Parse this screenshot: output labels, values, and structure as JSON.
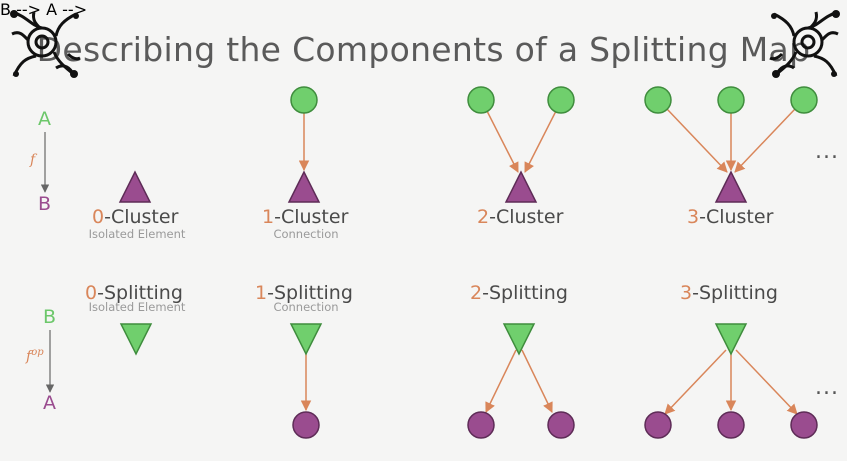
{
  "title": "Describing the Components of a Splitting Map",
  "colors": {
    "green_fill": "#70cf6d",
    "green_stroke": "#3f8d3d",
    "purple_fill": "#9a4c8f",
    "purple_stroke": "#5e2c57",
    "arrow": "#d9865a",
    "accent_number": "#d9865a",
    "text": "#4a4a4a"
  },
  "icons": {
    "corner_left": "ornament-icon",
    "corner_right": "ornament-icon"
  },
  "top_legend": {
    "top": "A",
    "function": "f",
    "bottom": "B"
  },
  "bottom_legend": {
    "top": "B",
    "function": "fop",
    "bottom": "A"
  },
  "clusters": [
    {
      "number": "0",
      "name": "-Cluster",
      "subtitle": "Isolated Element"
    },
    {
      "number": "1",
      "name": "-Cluster",
      "subtitle": "Connection"
    },
    {
      "number": "2",
      "name": "-Cluster",
      "subtitle": ""
    },
    {
      "number": "3",
      "name": "-Cluster",
      "subtitle": ""
    }
  ],
  "splittings": [
    {
      "number": "0",
      "name": "-Splitting",
      "subtitle": "Isolated Element"
    },
    {
      "number": "1",
      "name": "-Splitting",
      "subtitle": "Connection"
    },
    {
      "number": "2",
      "name": "-Splitting",
      "subtitle": ""
    },
    {
      "number": "3",
      "name": "-Splitting",
      "subtitle": ""
    }
  ],
  "ellipsis": "..."
}
